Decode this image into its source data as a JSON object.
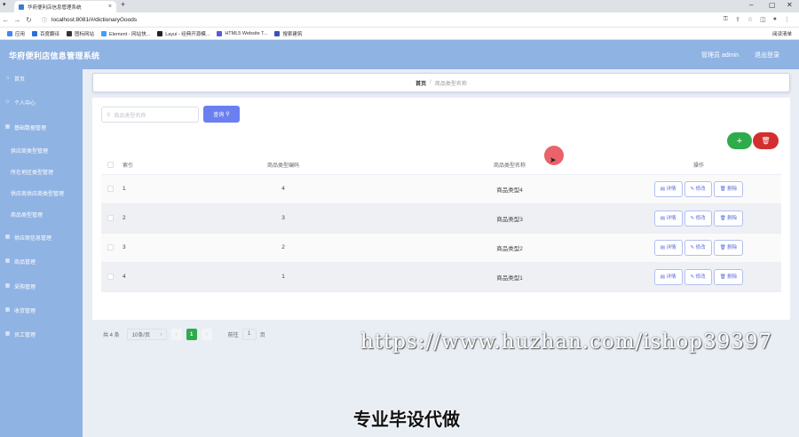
{
  "browser": {
    "tab_title": "华府便利店信息管理系统",
    "tab_close": "×",
    "new_tab": "+",
    "url": "localhost:8081/#/dictionaryGoods",
    "bookmarks": [
      {
        "label": "应用",
        "color": "#4285f4"
      },
      {
        "label": "百度翻译",
        "color": "#2a6fdb"
      },
      {
        "label": "图标网站",
        "color": "#333333"
      },
      {
        "label": "Element - 网站快...",
        "color": "#409eff"
      },
      {
        "label": "Layui - 经典开源模...",
        "color": "#222222"
      },
      {
        "label": "HTML5 Website T...",
        "color": "#5b5bd6"
      },
      {
        "label": "搜索建筑",
        "color": "#3f51b5"
      }
    ],
    "reading_list": "阅读清单"
  },
  "header": {
    "title": "华府便利店信息管理系统",
    "admin": "管理员 admin",
    "logout": "退出登录"
  },
  "sidebar": {
    "items": [
      {
        "label": "首页",
        "icon": "home-icon"
      },
      {
        "label": "个人中心",
        "icon": "user-icon"
      },
      {
        "label": "基础数据管理",
        "icon": "grid-icon"
      }
    ],
    "sub_items": [
      "供应商类型管理",
      "所在地区类型管理",
      "供应商供应商类型管理",
      "商品类型管理"
    ],
    "items2": [
      {
        "label": "供应商信息管理",
        "icon": "grid-icon"
      },
      {
        "label": "商品管理",
        "icon": "grid-icon"
      },
      {
        "label": "采购管理",
        "icon": "grid-icon"
      },
      {
        "label": "收货管理",
        "icon": "grid-icon"
      },
      {
        "label": "员工管理",
        "icon": "grid-icon"
      }
    ]
  },
  "breadcrumb": {
    "home": "首页",
    "sep": "/",
    "current": "商品类型名称"
  },
  "search": {
    "placeholder": "商品类型名称",
    "button": "查询"
  },
  "actions": {
    "add": "+",
    "delete": "🗑"
  },
  "table": {
    "headers": [
      "索引",
      "商品类型编码",
      "商品类型名称",
      "操作"
    ],
    "rows": [
      {
        "index": "1",
        "code": "4",
        "name": "商品类型4"
      },
      {
        "index": "2",
        "code": "3",
        "name": "商品类型3"
      },
      {
        "index": "3",
        "code": "2",
        "name": "商品类型2"
      },
      {
        "index": "4",
        "code": "1",
        "name": "商品类型1"
      }
    ],
    "row_buttons": {
      "detail": "详情",
      "edit": "修改",
      "delete": "删除"
    }
  },
  "pagination": {
    "total": "共 4 条",
    "page_size": "10条/页",
    "current_page": "1",
    "goto_label": "前往",
    "goto_value": "1",
    "page_unit": "页"
  },
  "overlay": {
    "watermark": "https://www.huzhan.com/ishop39397",
    "caption": "专业毕设代做"
  }
}
